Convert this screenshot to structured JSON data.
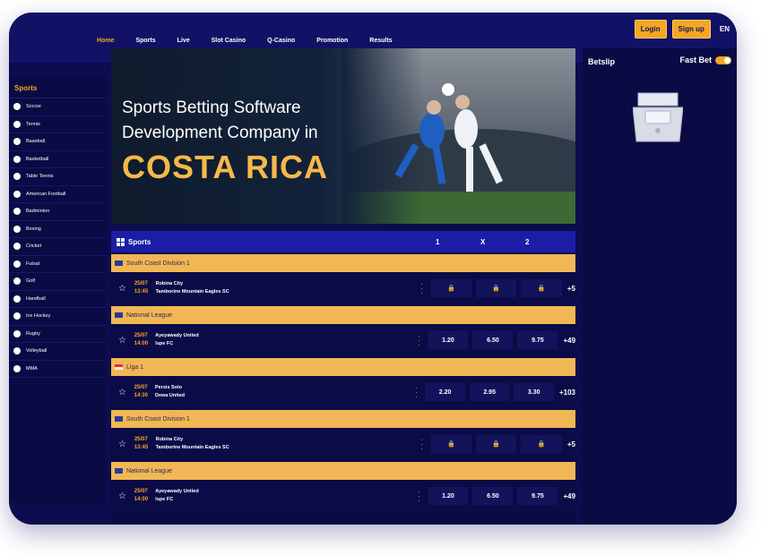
{
  "header": {
    "nav": [
      "Home",
      "Sports",
      "Live",
      "Slot Casino",
      "Q-Casino",
      "Promotion",
      "Results"
    ],
    "login": "Login",
    "signup": "Sign up",
    "language": "EN"
  },
  "sidebar": {
    "title": "Sports",
    "items": [
      {
        "label": "Soccer",
        "icon": "soccer-ball-icon"
      },
      {
        "label": "Tennis",
        "icon": "tennis-icon"
      },
      {
        "label": "Baseball",
        "icon": "baseball-icon"
      },
      {
        "label": "Basketball",
        "icon": "basketball-icon"
      },
      {
        "label": "Table Tennis",
        "icon": "table-tennis-icon"
      },
      {
        "label": "American Football",
        "icon": "american-football-icon"
      },
      {
        "label": "Badminton",
        "icon": "badminton-icon"
      },
      {
        "label": "Boxing",
        "icon": "boxing-icon"
      },
      {
        "label": "Cricket",
        "icon": "cricket-icon"
      },
      {
        "label": "Futsal",
        "icon": "futsal-icon"
      },
      {
        "label": "Golf",
        "icon": "golf-icon"
      },
      {
        "label": "Handball",
        "icon": "handball-icon"
      },
      {
        "label": "Ice Hockey",
        "icon": "ice-hockey-icon"
      },
      {
        "label": "Rugby",
        "icon": "rugby-icon"
      },
      {
        "label": "Volleyball",
        "icon": "volleyball-icon"
      },
      {
        "label": "MMA",
        "icon": "mma-icon"
      }
    ]
  },
  "banner": {
    "line1": "Sports Betting Software",
    "line2": "Development Company in",
    "line3": "COSTA RICA"
  },
  "odds": {
    "section_label": "Sports",
    "col1": "1",
    "colx": "X",
    "col2": "2",
    "blocks": [
      {
        "league": "South Coast Division 1",
        "date": "25/07",
        "time": "13:45",
        "home": "Robina City",
        "away": "Tamborine Mountain Eagles SC",
        "o1": "🔒",
        "ox": "🔒",
        "o2": "🔒",
        "more": "+5"
      },
      {
        "league": "National League",
        "date": "25/07",
        "time": "14:00",
        "home": "Ayeyawady United",
        "away": "Ispe FC",
        "o1": "1.20",
        "ox": "6.50",
        "o2": "9.75",
        "more": "+49"
      },
      {
        "league": "Liga 1",
        "date": "25/07",
        "time": "14:30",
        "home": "Persis Solo",
        "away": "Dewa United",
        "o1": "2.20",
        "ox": "2.95",
        "o2": "3.30",
        "more": "+103"
      },
      {
        "league": "South Coast Division 1",
        "date": "25/07",
        "time": "13:45",
        "home": "Robina City",
        "away": "Tamborine Mountain Eagles SC",
        "o1": "🔒",
        "ox": "🔒",
        "o2": "🔒",
        "more": "+5"
      },
      {
        "league": "National League",
        "date": "25/07",
        "time": "14:00",
        "home": "Ayeyawady United",
        "away": "Ispe FC",
        "o1": "1.20",
        "ox": "6.50",
        "o2": "9.75",
        "more": "+49"
      }
    ]
  },
  "betslip": {
    "title": "Betslip",
    "fast_bet": "Fast Bet"
  },
  "colors": {
    "accent": "#f5a623",
    "background": "#0c0c4e",
    "league_bar": "#f2b755"
  }
}
